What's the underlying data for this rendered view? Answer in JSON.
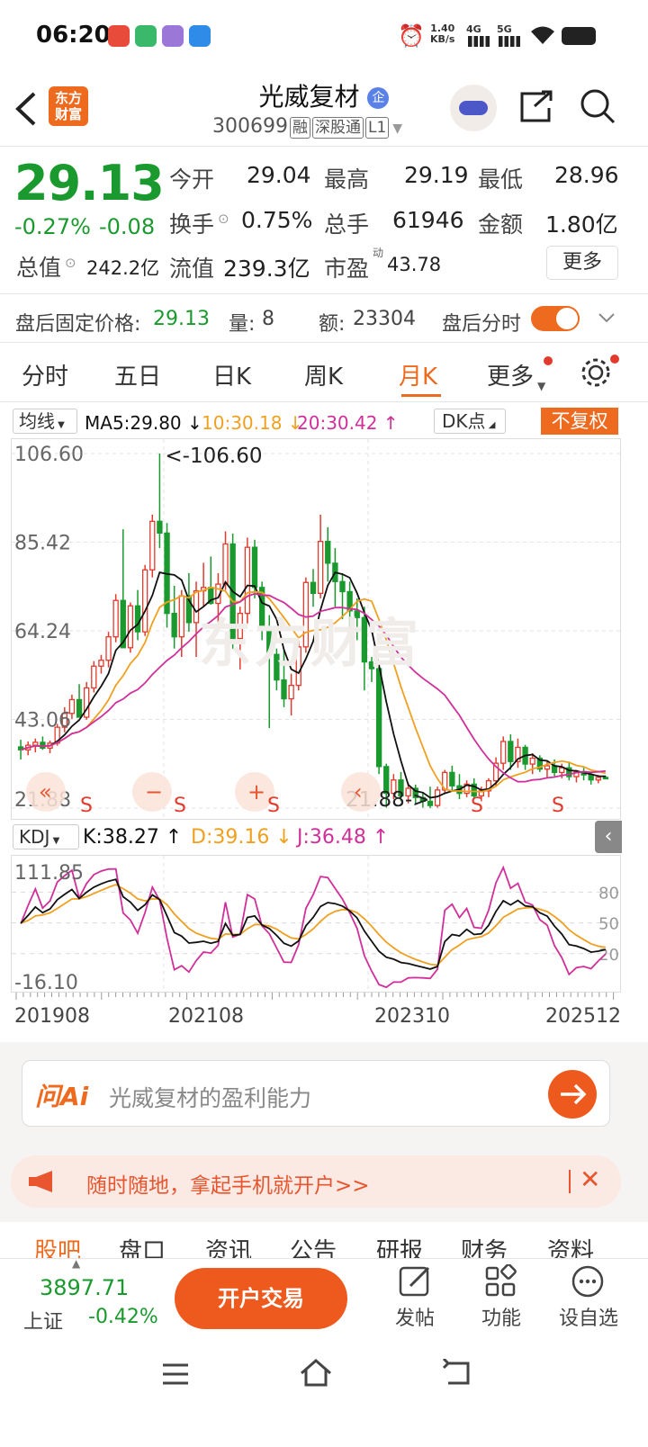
{
  "status_bar": {
    "time": "06:20",
    "net_speed_top": "1.40",
    "net_speed_bottom": "KB/s",
    "sig1": "4G",
    "sig2": "5G"
  },
  "header": {
    "back_icon": "chevron-left-icon",
    "logo_line1": "东方",
    "logo_line2": "财富",
    "stock_name": "光威复材",
    "badge": "企",
    "stock_code": "300699",
    "tags": [
      "融",
      "深股通",
      "L1"
    ],
    "share_icon": "share-icon",
    "search_icon": "search-icon"
  },
  "quote": {
    "price": "29.13",
    "change_pct": "-0.27%",
    "change_amt": "-0.08",
    "open_label": "今开",
    "open_value": "29.04",
    "high_label": "最高",
    "high_value": "29.19",
    "low_label": "最低",
    "low_value": "28.96",
    "turnover_label": "换手",
    "turnover_value": "0.75%",
    "volume_label": "总手",
    "volume_value": "61946",
    "amount_label": "金额",
    "amount_value": "1.80亿",
    "mktcap_label": "总值",
    "mktcap_value": "242.2亿",
    "float_label": "流值",
    "float_value": "239.3亿",
    "pe_label": "市盈",
    "pe_sup": "动",
    "pe_value": "43.78",
    "more_button": "更多"
  },
  "after_hours": {
    "price_label": "盘后固定价格:",
    "price_value": "29.13",
    "vol_label": "量:",
    "vol_value": "8",
    "amt_label": "额:",
    "amt_value": "23304",
    "timeshare_label": "盘后分时",
    "toggle_on": true
  },
  "tabs": [
    "分时",
    "五日",
    "日K",
    "周K",
    "月K",
    "更多"
  ],
  "active_tab": "月K",
  "chart_toolbar": {
    "ma_select": "均线",
    "ma5": "MA5:29.80 ↓",
    "ma10": "10:30.18 ↓",
    "ma20": "20:30.42 ↑",
    "dk_select": "DK点",
    "adjust_button": "不复权"
  },
  "kdj_toolbar": {
    "select": "KDJ",
    "k": "K:38.27 ↑",
    "d": "D:39.16 ↓",
    "j": "J:36.48 ↑"
  },
  "colors": {
    "up": "#e23a2d",
    "down": "#1a9a2e",
    "accent": "#ee6a1e",
    "ma5": "#111111",
    "ma10": "#f0a020",
    "ma20": "#d0309a"
  },
  "chart_data": [
    {
      "type": "candlestick",
      "title": "",
      "y_labels": [
        "106.60",
        "85.42",
        "64.24",
        "43.06",
        "21.88"
      ],
      "ylim": [
        21.88,
        106.6
      ],
      "annotations": [
        "<-106.60",
        "21.88->"
      ],
      "series_names": [
        "MA5",
        "MA10",
        "MA20"
      ],
      "candles": [
        [
          36.5,
          38.2,
          33.5,
          35.8
        ],
        [
          35.8,
          37.8,
          34.5,
          36.9
        ],
        [
          36.9,
          38.5,
          35.2,
          37.6
        ],
        [
          37.6,
          39.0,
          35.8,
          36.2
        ],
        [
          36.2,
          38.0,
          35.0,
          37.4
        ],
        [
          37.4,
          42.0,
          36.8,
          41.2
        ],
        [
          41.2,
          46.0,
          40.0,
          44.5
        ],
        [
          44.5,
          49.0,
          43.2,
          47.8
        ],
        [
          47.8,
          51.5,
          45.5,
          43.6
        ],
        [
          43.6,
          52.0,
          43.0,
          50.6
        ],
        [
          50.6,
          57.0,
          49.5,
          55.8
        ],
        [
          55.8,
          58.5,
          54.0,
          57.2
        ],
        [
          57.2,
          64.0,
          55.5,
          62.8
        ],
        [
          62.8,
          73.0,
          61.5,
          71.5
        ],
        [
          71.5,
          88.5,
          66.0,
          60.2
        ],
        [
          60.2,
          71.0,
          59.0,
          70.2
        ],
        [
          70.2,
          74.0,
          62.0,
          64.0
        ],
        [
          64.0,
          80.0,
          63.0,
          78.8
        ],
        [
          78.8,
          92.0,
          77.0,
          90.4
        ],
        [
          90.4,
          106.6,
          84.0,
          87.6
        ],
        [
          87.6,
          90.0,
          65.0,
          68.4
        ],
        [
          68.4,
          75.0,
          60.0,
          62.8
        ],
        [
          62.8,
          74.0,
          58.0,
          72.6
        ],
        [
          72.6,
          78.0,
          64.0,
          66.2
        ],
        [
          66.2,
          76.0,
          58.0,
          73.8
        ],
        [
          73.8,
          80.5,
          70.0,
          74.6
        ],
        [
          74.6,
          82.0,
          70.5,
          70.8
        ],
        [
          70.8,
          78.0,
          65.0,
          75.4
        ],
        [
          75.4,
          88.0,
          74.0,
          85.0
        ],
        [
          85.0,
          87.5,
          60.0,
          62.4
        ],
        [
          62.4,
          70.0,
          55.0,
          68.4
        ],
        [
          68.4,
          86.5,
          66.0,
          84.2
        ],
        [
          84.2,
          86.0,
          72.0,
          74.6
        ],
        [
          74.6,
          76.0,
          62.0,
          65.0
        ],
        [
          65.0,
          68.0,
          41.0,
          58.6
        ],
        [
          58.6,
          60.0,
          50.0,
          52.5
        ],
        [
          52.5,
          60.0,
          46.0,
          48.0
        ],
        [
          48.0,
          54.0,
          44.0,
          51.2
        ],
        [
          51.2,
          62.0,
          50.0,
          60.4
        ],
        [
          60.4,
          77.0,
          59.0,
          75.8
        ],
        [
          75.8,
          79.0,
          70.0,
          73.2
        ],
        [
          73.2,
          92.0,
          72.0,
          85.6
        ],
        [
          85.6,
          89.0,
          76.0,
          80.4
        ],
        [
          80.4,
          84.0,
          70.0,
          76.0
        ],
        [
          76.0,
          78.0,
          67.0,
          73.6
        ],
        [
          73.6,
          76.0,
          65.0,
          69.0
        ],
        [
          69.0,
          72.0,
          62.0,
          67.4
        ],
        [
          67.4,
          70.0,
          50.0,
          56.8
        ],
        [
          56.8,
          58.0,
          52.0,
          55.2
        ],
        [
          55.2,
          56.0,
          30.0,
          31.8
        ],
        [
          31.8,
          32.5,
          22.0,
          25.4
        ],
        [
          25.4,
          30.0,
          24.0,
          28.6
        ],
        [
          28.6,
          30.5,
          23.5,
          24.8
        ],
        [
          24.8,
          28.0,
          23.0,
          26.6
        ],
        [
          26.6,
          27.5,
          23.0,
          24.4
        ],
        [
          24.4,
          25.5,
          22.0,
          23.5
        ],
        [
          23.5,
          27.0,
          21.9,
          22.5
        ],
        [
          22.5,
          27.0,
          22.0,
          26.2
        ],
        [
          26.2,
          31.0,
          25.5,
          30.4
        ],
        [
          30.4,
          32.0,
          26.0,
          27.2
        ],
        [
          27.2,
          30.0,
          24.0,
          25.4
        ],
        [
          25.4,
          28.5,
          24.5,
          27.6
        ],
        [
          27.6,
          29.0,
          24.0,
          24.8
        ],
        [
          24.8,
          27.0,
          23.5,
          26.0
        ],
        [
          26.0,
          29.0,
          24.5,
          28.4
        ],
        [
          28.4,
          34.0,
          27.0,
          32.6
        ],
        [
          32.6,
          39.0,
          31.0,
          37.8
        ],
        [
          37.8,
          39.5,
          31.0,
          33.0
        ],
        [
          33.0,
          38.5,
          31.5,
          36.4
        ],
        [
          36.4,
          37.0,
          31.0,
          32.4
        ],
        [
          32.4,
          35.0,
          30.0,
          33.8
        ],
        [
          33.8,
          34.5,
          30.5,
          31.2
        ],
        [
          31.2,
          33.0,
          29.0,
          32.0
        ],
        [
          32.0,
          33.5,
          29.5,
          30.4
        ],
        [
          30.4,
          32.5,
          29.0,
          31.5
        ],
        [
          31.5,
          33.0,
          28.5,
          29.4
        ],
        [
          29.4,
          31.0,
          28.0,
          30.6
        ],
        [
          30.6,
          31.5,
          28.5,
          29.8
        ],
        [
          29.8,
          30.5,
          27.5,
          28.6
        ],
        [
          28.6,
          29.8,
          27.8,
          29.2
        ],
        [
          29.2,
          29.6,
          28.8,
          29.13
        ]
      ]
    },
    {
      "type": "line",
      "title": "",
      "y_labels": [
        "111.85",
        "-16.10"
      ],
      "right_labels": [
        "80",
        "50",
        "20"
      ],
      "ylim": [
        -16.1,
        111.85
      ],
      "x_labels": [
        "201908",
        "202108",
        "202310",
        "202512"
      ]
    }
  ],
  "ask_ai": {
    "logo": "问Ai",
    "placeholder": "光威复材的盈利能力"
  },
  "promo": {
    "text": "随时随地，拿起手机就开户>>"
  },
  "section_tabs": [
    "股吧",
    "盘口",
    "资讯",
    "公告",
    "研报",
    "财务",
    "资料"
  ],
  "bottom_bar": {
    "index_value": "3897.71",
    "index_name": "上证",
    "index_change": "-0.42%",
    "trade_button": "开户交易",
    "post_label": "发帖",
    "func_label": "功能",
    "watch_label": "设自选"
  }
}
